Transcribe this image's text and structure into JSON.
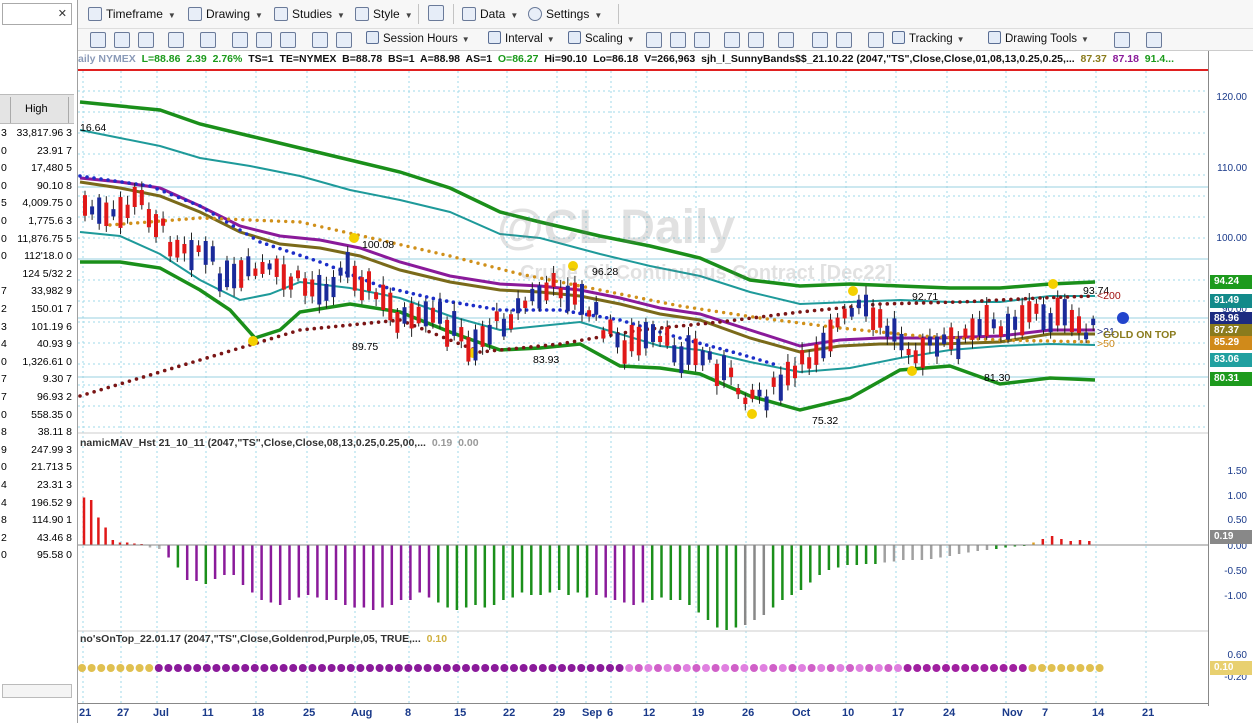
{
  "left": {
    "header_label": "High",
    "rows": [
      {
        "p": "3",
        "v": "33,817.96 3"
      },
      {
        "p": "0",
        "v": "23.91 7"
      },
      {
        "p": "0",
        "v": "17,480 5"
      },
      {
        "p": "0",
        "v": "90.10 8"
      },
      {
        "p": "5",
        "v": "4,009.75 0"
      },
      {
        "p": "0",
        "v": "1,775.6 3"
      },
      {
        "p": "0",
        "v": "11,876.75 5"
      },
      {
        "p": "0",
        "v": "112'18.0 0"
      },
      {
        "p": "",
        "v": "124  5/32  2"
      },
      {
        "p": "7",
        "v": "33,982 9"
      },
      {
        "p": "2",
        "v": "150.01 7"
      },
      {
        "p": "3",
        "v": "101.19 6"
      },
      {
        "p": "4",
        "v": "40.93 9"
      },
      {
        "p": "0",
        "v": "1,326.61 0"
      },
      {
        "p": "7",
        "v": "9.30 7"
      },
      {
        "p": "7",
        "v": "96.93 2"
      },
      {
        "p": "0",
        "v": "558.35 0"
      },
      {
        "p": "8",
        "v": "38.11 8"
      },
      {
        "p": "9",
        "v": "247.99 3"
      },
      {
        "p": "0",
        "v": "21.713 5"
      },
      {
        "p": "4",
        "v": "23.31 3"
      },
      {
        "p": "4",
        "v": "196.52 9"
      },
      {
        "p": "8",
        "v": "114.90 1"
      },
      {
        "p": "2",
        "v": "43.46 8"
      },
      {
        "p": "0",
        "v": "95.58 0"
      }
    ]
  },
  "toolbar1": {
    "timeframe": "Timeframe",
    "drawing": "Drawing",
    "studies": "Studies",
    "style": "Style",
    "data": "Data",
    "settings": "Settings"
  },
  "toolbar2": {
    "session_hours": "Session Hours",
    "interval": "Interval",
    "scaling": "Scaling",
    "tracking": "Tracking",
    "drawing_tools": "Drawing Tools"
  },
  "status": {
    "symbol": "aily  NYMEX",
    "low": "L=88.86",
    "chg": "2.39",
    "pct": "2.76%",
    "ts": "TS=1",
    "te": "TE=NYMEX",
    "b": "B=88.78",
    "bs": "BS=1",
    "a": "A=88.98",
    "as": "AS=1",
    "open": "O=86.27",
    "hi": "Hi=90.10",
    "lo": "Lo=86.18",
    "vol": "V=266,963",
    "study": "sjh_l_SunnyBands$$_21.10.22 (2047,\"TS\",Close,Close,01,08,13,0.25,0.25,...",
    "v1": "87.37",
    "v2": "87.18",
    "v3": "91.4..."
  },
  "watermark": {
    "line1": "@CL Daily",
    "line2": "Crude Oil Continuous Contract [Dec22]"
  },
  "price_labels": {
    "l1": "16.64",
    "l2": "100.08",
    "l3": "89.75",
    "l4": "96.28",
    "l5": "83.93",
    "l6": "75.32",
    "l7": "92.71",
    "l8": "81.30",
    "l9": "93.74",
    "l10": "200",
    "l11": "21",
    "l12": "GOLD ON TOP",
    "l13": "50"
  },
  "indicators": {
    "mav_label": "namicMAV_Hst 21_10_11 (2047,\"TS\",Close,Close,08,13,0.25,0.25,00,...",
    "mav_v1": "0.19",
    "mav_v2": "0.00",
    "got_label": "no'sOnTop_22.01.17 (2047,\"TS\",Close,Goldenrod,Purple,05, TRUE,...",
    "got_v1": "0.10"
  },
  "axis": {
    "price_ticks": [
      "120.00",
      "110.00",
      "100.00",
      "90.00",
      "80.00"
    ],
    "tags": [
      {
        "v": "94.24",
        "c": "#1d9a1d"
      },
      {
        "v": "91.49",
        "c": "#138a8a"
      },
      {
        "v": "88.96",
        "c": "#1c2b80"
      },
      {
        "v": "87.37",
        "c": "#8a7b1c"
      },
      {
        "v": "85.29",
        "c": "#d08a1a"
      },
      {
        "v": "83.06",
        "c": "#20a0a0"
      },
      {
        "v": "80.31",
        "c": "#1d9a1d"
      }
    ],
    "osc_ticks": [
      "1.50",
      "1.00",
      "0.50",
      "0.00",
      "-0.50",
      "-1.00"
    ],
    "osc_tag": "0.19",
    "got_ticks": [
      "0.60",
      "0.20",
      "-0.20"
    ],
    "got_tag": "0.10"
  },
  "dates": [
    "21",
    "27",
    "Jul",
    "11",
    "18",
    "25",
    "Aug",
    "8",
    "15",
    "22",
    "29",
    "Sep",
    "6",
    "12",
    "19",
    "26",
    "Oct",
    "10",
    "17",
    "24",
    "Nov",
    "7",
    "14",
    "21"
  ],
  "colors": {
    "green": "#1a8f1a",
    "teal": "#1e9a9a",
    "purple": "#8a1a9a",
    "olive": "#7a6a1a",
    "blue": "#1c2ec8",
    "maroon": "#8a1a1a",
    "orange": "#d0901a",
    "yellow": "#f4d000",
    "up": "#1a2a9a",
    "down": "#e01818"
  }
}
